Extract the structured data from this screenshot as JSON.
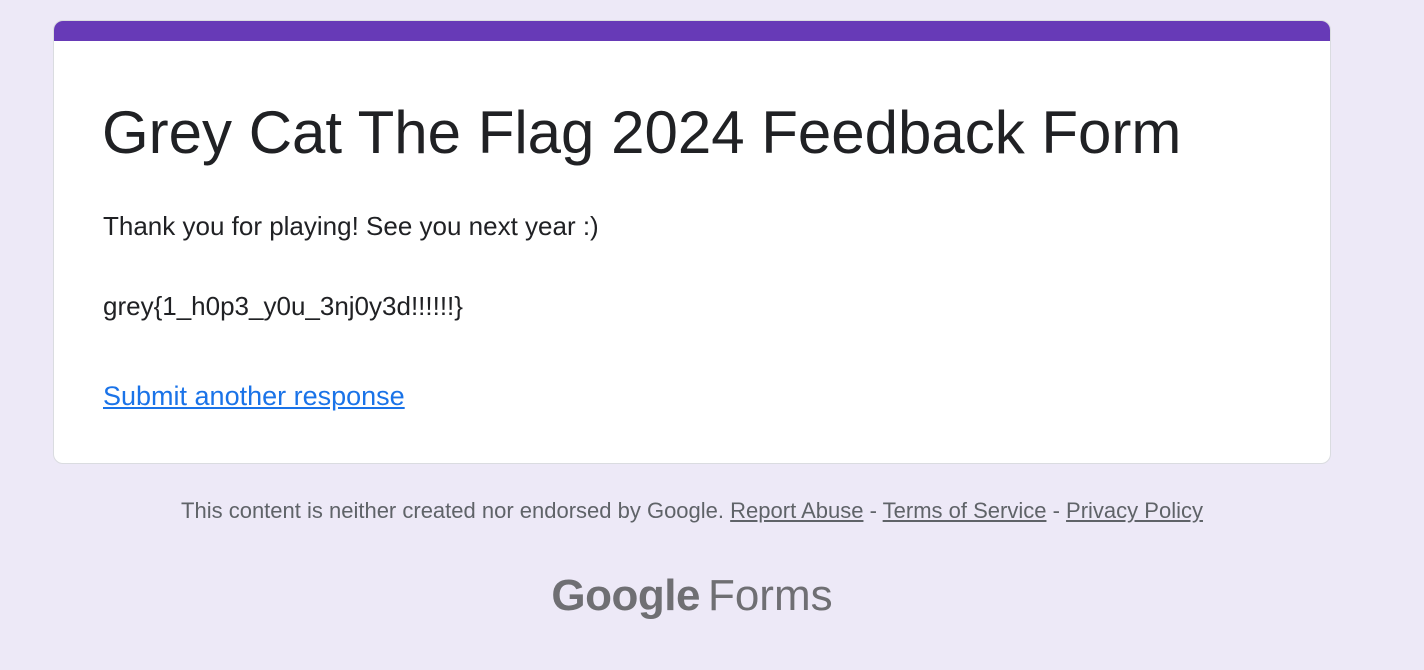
{
  "form": {
    "title": "Grey Cat The Flag 2024 Feedback Form",
    "confirmation_message": "Thank you for playing! See you next year :)",
    "flag_text": "grey{1_h0p3_y0u_3nj0y3d!!!!!!}",
    "submit_another_label": "Submit another response"
  },
  "footer": {
    "disclaimer": "This content is neither created nor endorsed by Google.",
    "separator": "-",
    "links": [
      {
        "label": "Report Abuse"
      },
      {
        "label": "Terms of Service"
      },
      {
        "label": "Privacy Policy"
      }
    ],
    "brand_google": "Google",
    "brand_product": "Forms"
  },
  "colors": {
    "background": "#ede9f7",
    "accent": "#673ab7",
    "link": "#1a73e8",
    "text": "#202124",
    "muted_text": "#5f6368"
  }
}
